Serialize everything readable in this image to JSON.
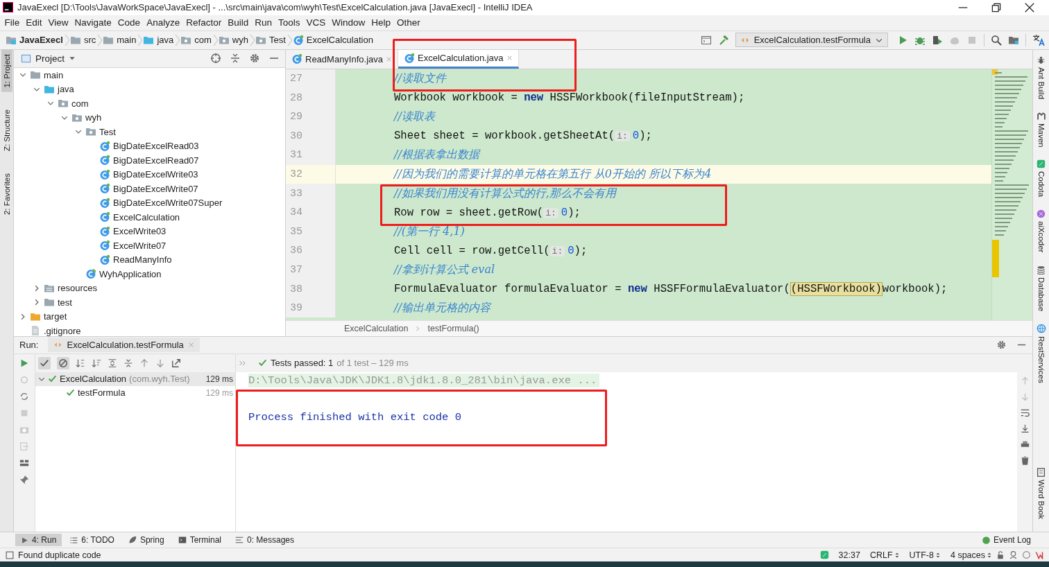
{
  "window": {
    "title": "JavaExecl [D:\\Tools\\JavaWorkSpace\\JavaExecl] - ...\\src\\main\\java\\com\\wyh\\Test\\ExcelCalculation.java [JavaExecl] - IntelliJ IDEA"
  },
  "menu": [
    "File",
    "Edit",
    "View",
    "Navigate",
    "Code",
    "Analyze",
    "Refactor",
    "Build",
    "Run",
    "Tools",
    "VCS",
    "Window",
    "Help",
    "Other"
  ],
  "breadcrumbs": [
    {
      "label": "JavaExecl",
      "kind": "project"
    },
    {
      "label": "src",
      "kind": "folder"
    },
    {
      "label": "main",
      "kind": "folder"
    },
    {
      "label": "java",
      "kind": "source-folder"
    },
    {
      "label": "com",
      "kind": "package"
    },
    {
      "label": "wyh",
      "kind": "package"
    },
    {
      "label": "Test",
      "kind": "package"
    },
    {
      "label": "ExcelCalculation",
      "kind": "class"
    }
  ],
  "run_config": {
    "label": "ExcelCalculation.testFormula"
  },
  "left_strip": [
    "1: Project",
    "Z: Structure",
    "2: Favorites"
  ],
  "right_strip": [
    {
      "label": "Ant Build",
      "kind": "ant"
    },
    {
      "label": "Maven",
      "kind": "maven"
    },
    {
      "label": "Codota",
      "kind": "codota"
    },
    {
      "label": "aiXcoder",
      "kind": "aixcoder"
    },
    {
      "label": "Database",
      "kind": "database"
    },
    {
      "label": "RestServices",
      "kind": "rest"
    },
    {
      "label": "Word Book",
      "kind": "book"
    }
  ],
  "project_panel": {
    "title": "Project",
    "tree": [
      {
        "label": "main",
        "kind": "folder",
        "expanded": true,
        "children": [
          {
            "label": "java",
            "kind": "source-folder",
            "expanded": true,
            "children": [
              {
                "label": "com",
                "kind": "package",
                "expanded": true,
                "children": [
                  {
                    "label": "wyh",
                    "kind": "package",
                    "expanded": true,
                    "children": [
                      {
                        "label": "Test",
                        "kind": "package",
                        "expanded": true,
                        "children": [
                          {
                            "label": "BigDateExcelRead03",
                            "kind": "class"
                          },
                          {
                            "label": "BigDateExcelRead07",
                            "kind": "class"
                          },
                          {
                            "label": "BigDateExcelWrite03",
                            "kind": "class"
                          },
                          {
                            "label": "BigDateExcelWrite07",
                            "kind": "class"
                          },
                          {
                            "label": "BigDateExcelWrite07Super",
                            "kind": "class"
                          },
                          {
                            "label": "ExcelCalculation",
                            "kind": "class"
                          },
                          {
                            "label": "ExcelWrite03",
                            "kind": "class"
                          },
                          {
                            "label": "ExcelWrite07",
                            "kind": "class"
                          },
                          {
                            "label": "ReadManyInfo",
                            "kind": "class"
                          }
                        ]
                      },
                      {
                        "label": "WyhApplication",
                        "kind": "spring-class"
                      }
                    ]
                  }
                ]
              }
            ]
          },
          {
            "label": "resources",
            "kind": "resources-folder",
            "expanded": false
          },
          {
            "label": "test",
            "kind": "folder",
            "expanded": false
          }
        ]
      },
      {
        "label": "target",
        "kind": "excluded-folder",
        "expanded": false
      },
      {
        "label": ".gitignore",
        "kind": "file"
      }
    ]
  },
  "editor": {
    "tabs": [
      {
        "label": "ReadManyInfo.java",
        "selected": false
      },
      {
        "label": "ExcelCalculation.java",
        "selected": true
      }
    ],
    "lines": [
      {
        "number": "27",
        "kind": "comment",
        "current": false,
        "text": "//读取文件"
      },
      {
        "number": "28",
        "kind": "code",
        "current": false,
        "tokens": [
          {
            "kind": "plain",
            "text": "Workbook workbook = "
          },
          {
            "kind": "keyword",
            "text": "new"
          },
          {
            "kind": "plain",
            "text": " HSSFWorkbook(fileInputStream);"
          }
        ]
      },
      {
        "number": "29",
        "kind": "comment",
        "current": false,
        "text": "//读取表"
      },
      {
        "number": "30",
        "kind": "code",
        "current": false,
        "tokens": [
          {
            "kind": "plain",
            "text": "Sheet sheet = workbook.getSheetAt("
          },
          {
            "kind": "hint",
            "text": "i:"
          },
          {
            "kind": "number",
            "text": "0"
          },
          {
            "kind": "plain",
            "text": ");"
          }
        ]
      },
      {
        "number": "31",
        "kind": "comment",
        "current": false,
        "text": "//根据表拿出数据"
      },
      {
        "number": "32",
        "kind": "comment",
        "current": true,
        "text": "//因为我们的需要计算的单元格在第五行 从0开始的 所以下标为4"
      },
      {
        "number": "33",
        "kind": "comment",
        "current": false,
        "text": "//如果我们用没有计算公式的行,那么不会有用"
      },
      {
        "number": "34",
        "kind": "code",
        "current": false,
        "tokens": [
          {
            "kind": "plain",
            "text": "Row row = sheet.getRow("
          },
          {
            "kind": "hint",
            "text": "i:"
          },
          {
            "kind": "number",
            "text": "0"
          },
          {
            "kind": "plain",
            "text": ");"
          }
        ]
      },
      {
        "number": "35",
        "kind": "comment",
        "current": false,
        "text": "//(第一行 4,1)"
      },
      {
        "number": "36",
        "kind": "code",
        "current": false,
        "tokens": [
          {
            "kind": "plain",
            "text": "Cell cell = row.getCell("
          },
          {
            "kind": "hint",
            "text": "i:"
          },
          {
            "kind": "number",
            "text": "0"
          },
          {
            "kind": "plain",
            "text": ");"
          }
        ]
      },
      {
        "number": "37",
        "kind": "comment",
        "current": false,
        "text": "//拿到计算公式 eval"
      },
      {
        "number": "38",
        "kind": "code",
        "current": false,
        "tokens": [
          {
            "kind": "plain",
            "text": "FormulaEvaluator formulaEvaluator = "
          },
          {
            "kind": "keyword",
            "text": "new"
          },
          {
            "kind": "plain",
            "text": " HSSFFormulaEvaluator("
          },
          {
            "kind": "cast",
            "text": "(HSSFWorkbook)"
          },
          {
            "kind": "plain",
            "text": "workbook);"
          }
        ]
      },
      {
        "number": "39",
        "kind": "comment",
        "current": false,
        "text": "//输出单元格的内容"
      }
    ],
    "breadcrumb": [
      "ExcelCalculation",
      "testFormula()"
    ]
  },
  "run_panel": {
    "label": "Run:",
    "tab": "ExcelCalculation.testFormula",
    "summary": "Tests passed: 1",
    "summary_detail": "of 1 test – 129 ms",
    "tests": [
      {
        "name": "ExcelCalculation",
        "detail": "(com.wyh.Test)",
        "time": "129 ms",
        "passed": true,
        "expanded": true,
        "children": [
          {
            "name": "testFormula",
            "time": "129 ms",
            "passed": true
          }
        ]
      }
    ],
    "console": [
      {
        "kind": "command",
        "text": "D:\\Tools\\Java\\JDK\\JDK1.8\\jdk1.8.0_281\\bin\\java.exe ..."
      },
      {
        "kind": "output",
        "text": "Process finished with exit code 0"
      }
    ]
  },
  "tool_tabs": [
    {
      "label": "4: Run",
      "kind": "run",
      "selected": true
    },
    {
      "label": "6: TODO",
      "kind": "todo",
      "selected": false
    },
    {
      "label": "Spring",
      "kind": "spring",
      "selected": false
    },
    {
      "label": "Terminal",
      "kind": "terminal",
      "selected": false
    },
    {
      "label": "0: Messages",
      "kind": "messages",
      "selected": false
    }
  ],
  "event_log": "Event Log",
  "status_bar": {
    "message": "Found duplicate code",
    "position": "32:37",
    "line_separator": "CRLF",
    "encoding": "UTF-8",
    "indent": "4 spaces"
  }
}
